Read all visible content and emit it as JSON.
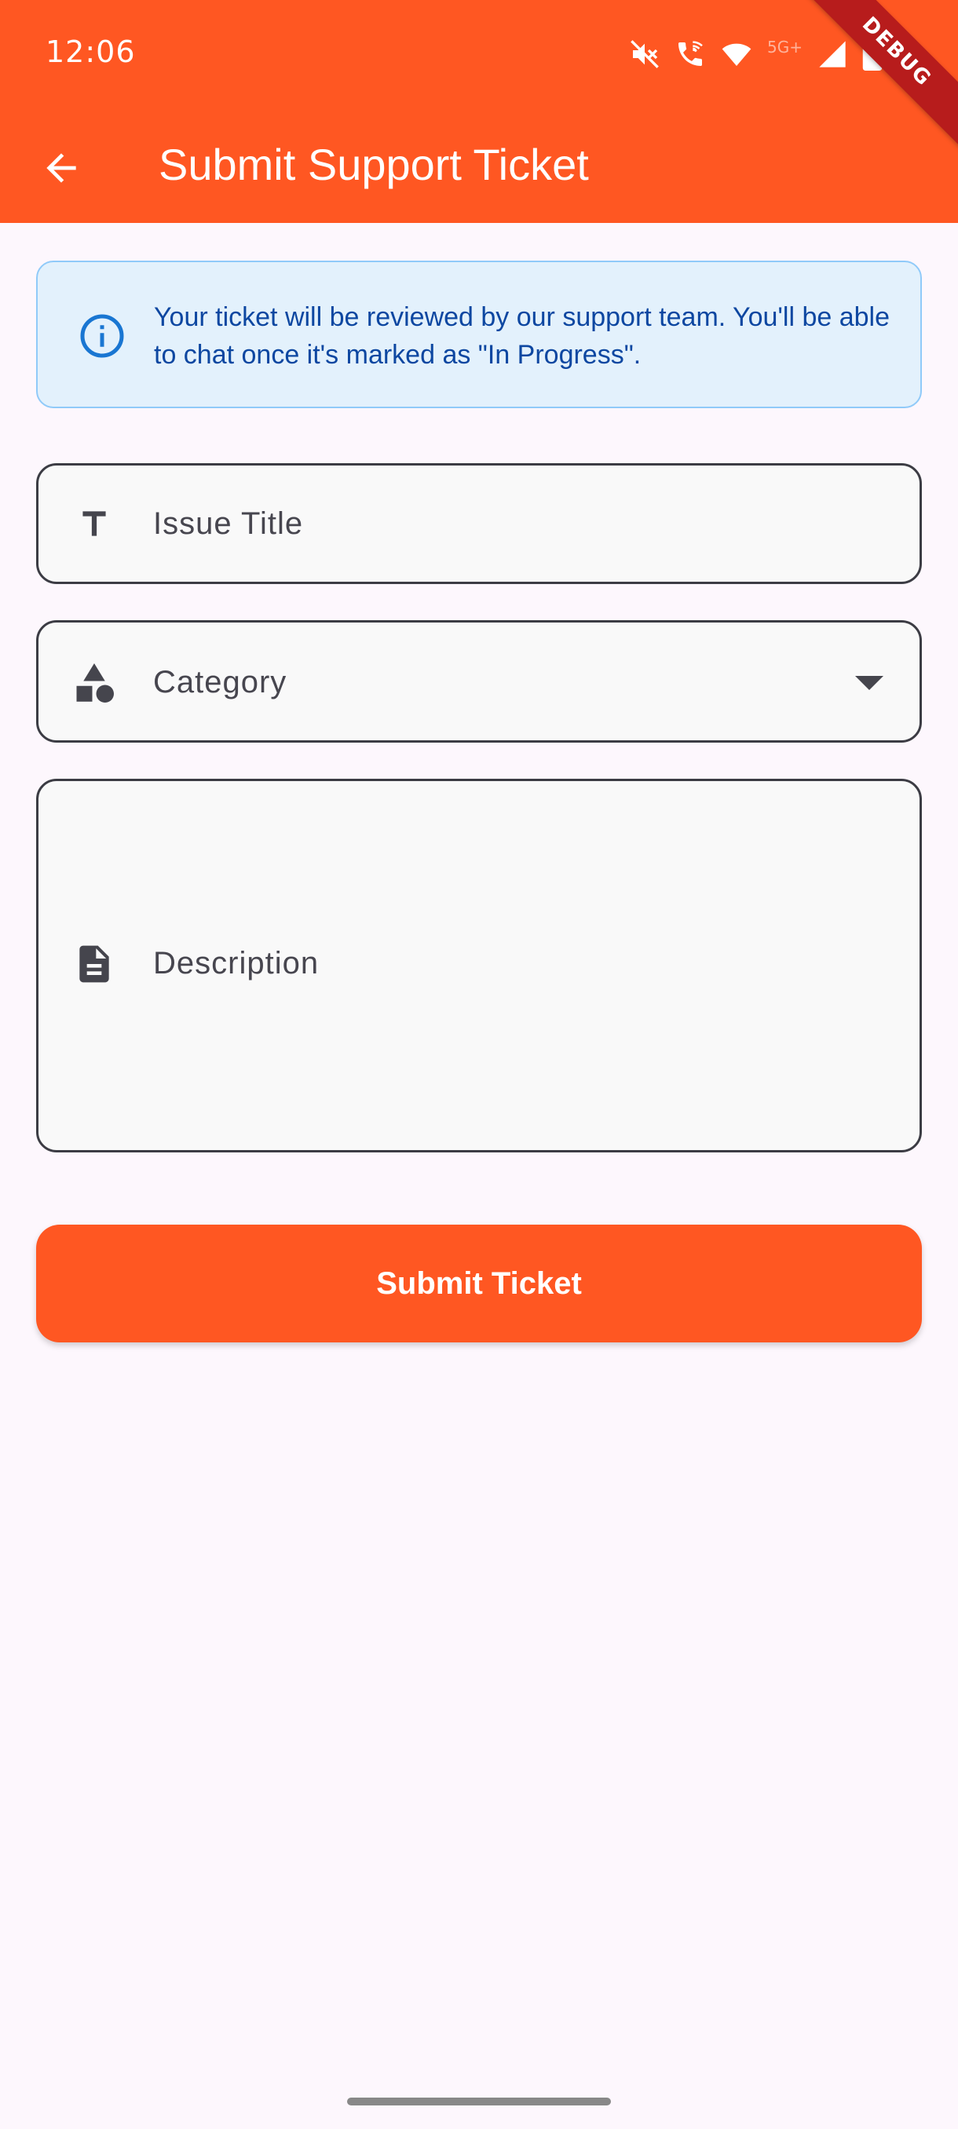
{
  "status_bar": {
    "time": "12:06",
    "icons": [
      "mute-icon",
      "wifi-calling-icon",
      "wifi-icon",
      "signal-icon",
      "battery-icon"
    ],
    "network_label": "5G+"
  },
  "debug_banner": "DEBUG",
  "app_bar": {
    "title": "Submit Support Ticket",
    "back_icon": "arrow-back-icon",
    "color": "#FF5722"
  },
  "info_box": {
    "icon": "info-icon",
    "text": "Your ticket will be reviewed by our support team. You'll be able to chat once it's marked as \"In Progress\".",
    "background": "#E3F1FC",
    "text_color": "#0D47A1"
  },
  "form": {
    "issue_title": {
      "label": "Issue Title",
      "icon": "title-icon",
      "value": ""
    },
    "category": {
      "label": "Category",
      "icon": "category-shapes-icon",
      "value": ""
    },
    "description": {
      "label": "Description",
      "icon": "document-icon",
      "value": ""
    }
  },
  "submit_button": {
    "label": "Submit Ticket",
    "color": "#FF5722"
  }
}
